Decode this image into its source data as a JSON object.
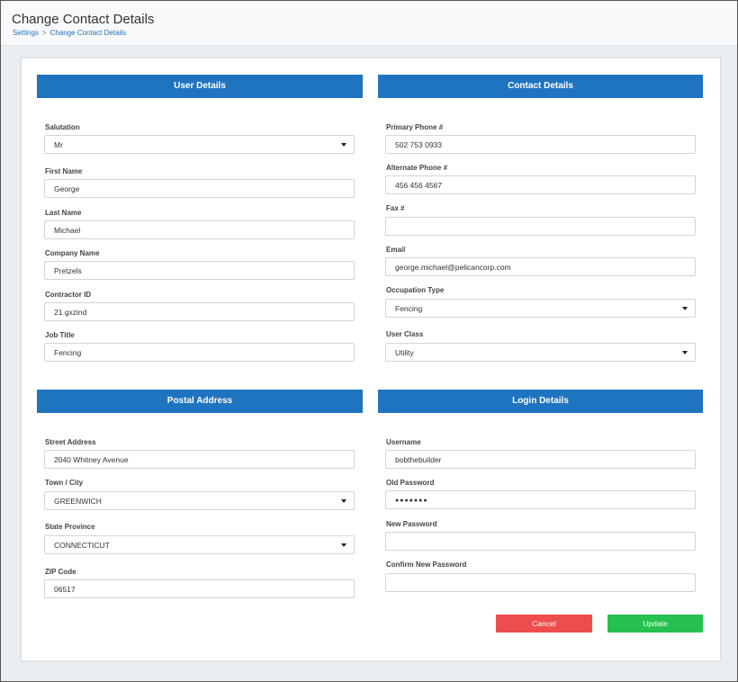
{
  "header": {
    "title": "Change Contact Details",
    "breadcrumb": [
      "Settings",
      "Change Contact Details"
    ],
    "breadcrumb_sep": ">"
  },
  "sections": {
    "user": "User Details",
    "contact": "Contact Details",
    "postal": "Postal Address",
    "login": "Login Details"
  },
  "user": {
    "salutation_label": "Salutation",
    "salutation": "Mr",
    "first_name_label": "First Name",
    "first_name": "George",
    "last_name_label": "Last Name",
    "last_name": "Michael",
    "company_label": "Company Name",
    "company": "Pretzels",
    "contractor_label": "Contractor ID",
    "contractor": "21 gxzind",
    "job_label": "Job Title",
    "job": "Fencing"
  },
  "contact": {
    "primary_label": "Primary Phone #",
    "primary": "502 753 0933",
    "alternate_label": "Alternate Phone #",
    "alternate": "456 456 4567",
    "fax_label": "Fax #",
    "fax": "",
    "email_label": "Email",
    "email": "george.michael@pelicancorp.com",
    "occupation_label": "Occupation Type",
    "occupation": "Fencing",
    "class_label": "User Class",
    "user_class": "Utility"
  },
  "postal": {
    "street_label": "Street Address",
    "street": "2040 Whitney Avenue",
    "town_label": "Town / City",
    "town": "GREENWICH",
    "state_label": "State Province",
    "state": "CONNECTICUT",
    "zip_label": "ZIP Code",
    "zip": "06517"
  },
  "login": {
    "username_label": "Username",
    "username": "bobthebuilder",
    "old_pw_label": "Old Password",
    "old_pw": "●●●●●●●",
    "new_pw_label": "New Password",
    "new_pw": "",
    "confirm_pw_label": "Confirm New Password",
    "confirm_pw": ""
  },
  "buttons": {
    "cancel": "Cancel",
    "update": "Update"
  },
  "colors": {
    "header": "#1f74bf",
    "cancel": "#ee4d4d",
    "update": "#26c04f",
    "link": "#2a72b5"
  }
}
